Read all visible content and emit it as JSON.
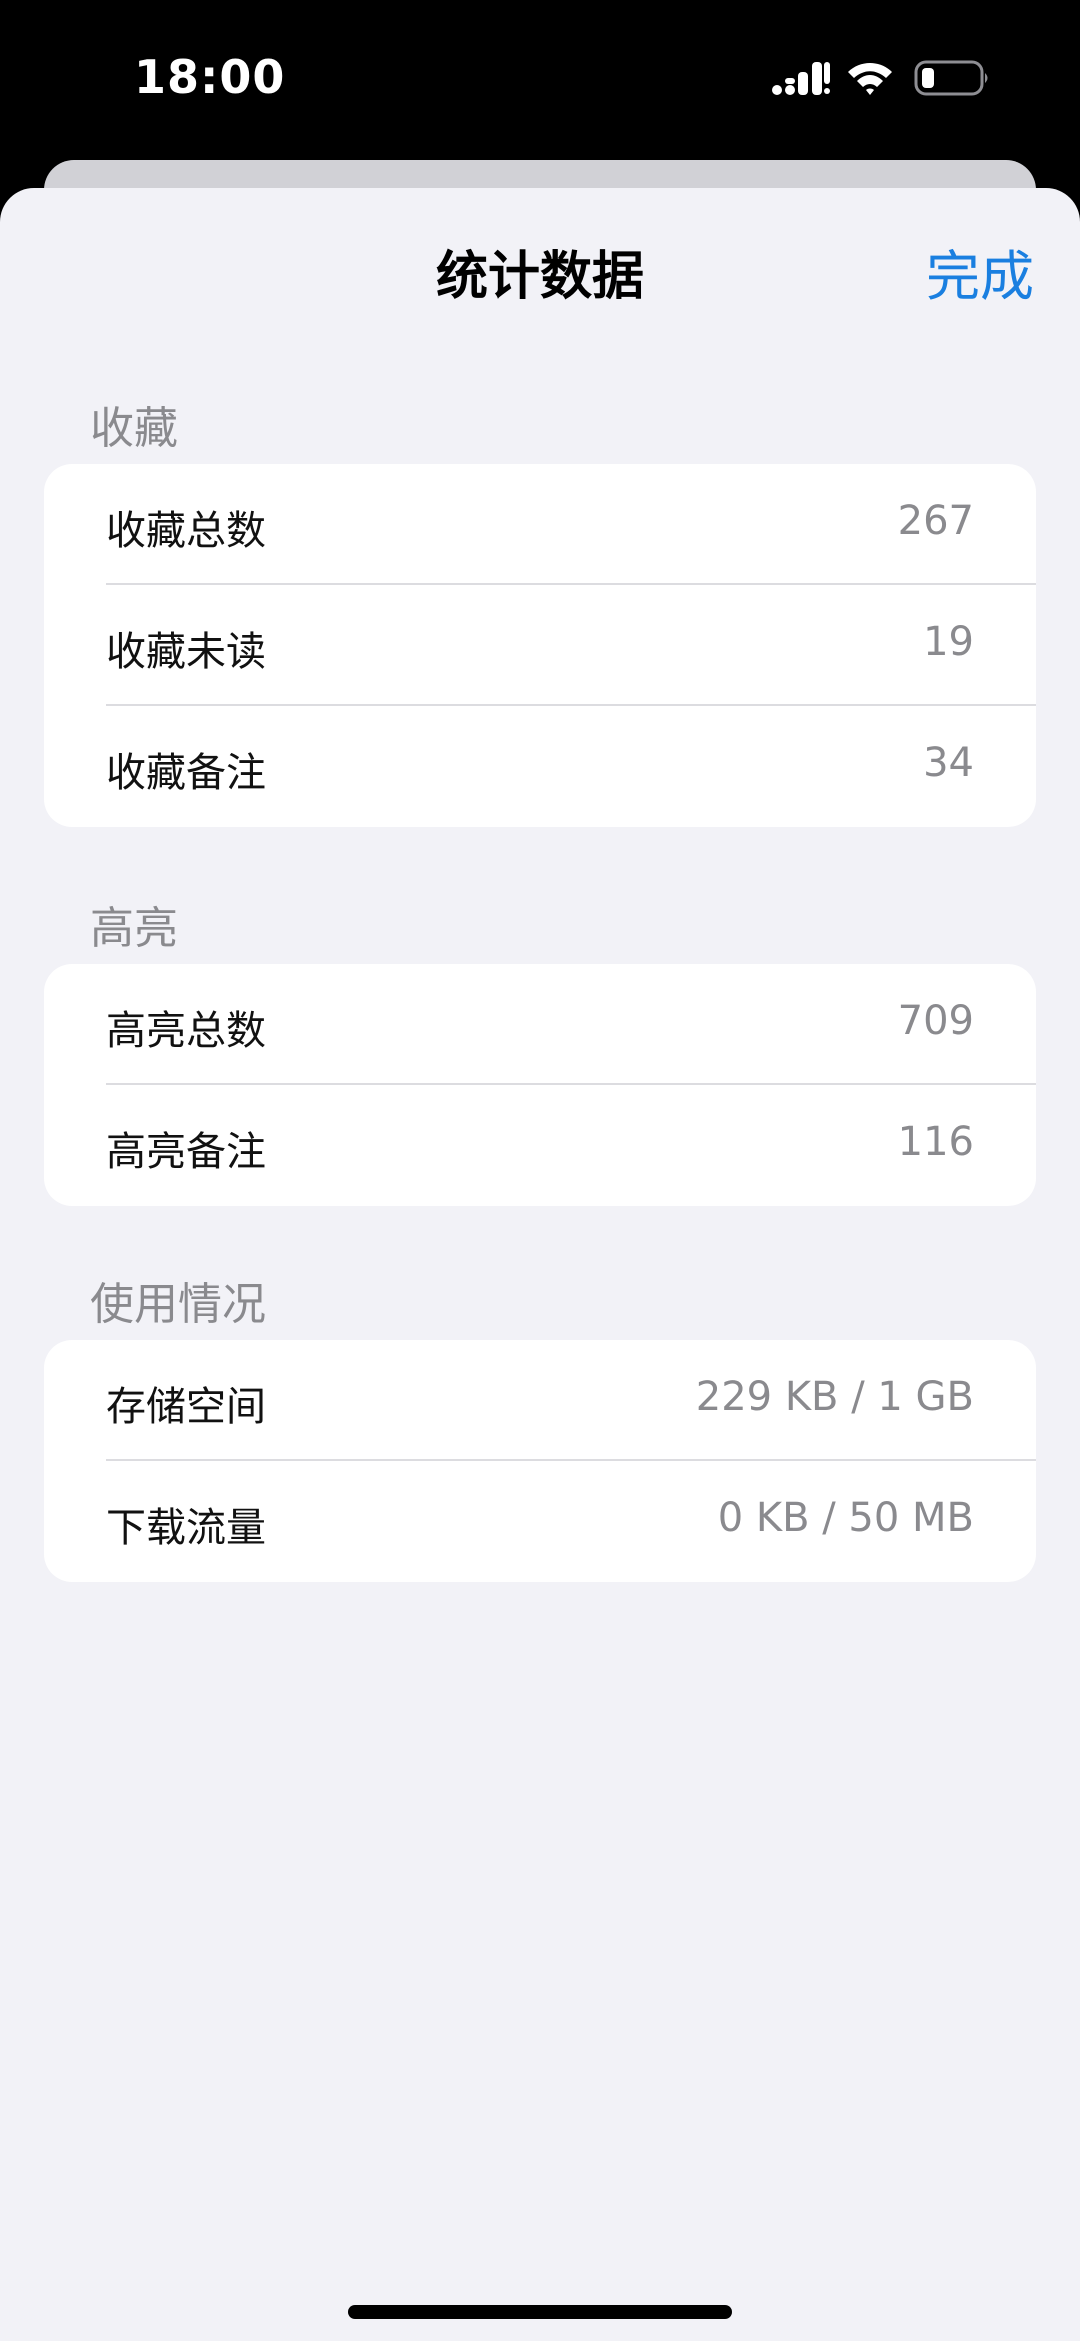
{
  "status_bar": {
    "time": "18:00"
  },
  "nav": {
    "title": "统计数据",
    "done_label": "完成",
    "accent_color": "#1a7fe0"
  },
  "sections": {
    "favorites": {
      "header": "收藏",
      "rows": [
        {
          "label": "收藏总数",
          "value": "267"
        },
        {
          "label": "收藏未读",
          "value": "19"
        },
        {
          "label": "收藏备注",
          "value": "34"
        }
      ]
    },
    "highlights": {
      "header": "高亮",
      "rows": [
        {
          "label": "高亮总数",
          "value": "709"
        },
        {
          "label": "高亮备注",
          "value": "116"
        }
      ]
    },
    "usage": {
      "header": "使用情况",
      "rows": [
        {
          "label": "存储空间",
          "value": "229 KB / 1 GB"
        },
        {
          "label": "下载流量",
          "value": "0 KB / 50 MB"
        }
      ]
    }
  },
  "icons": {
    "signal": "cellular-signal-icon",
    "wifi": "wifi-icon",
    "battery": "battery-icon"
  }
}
